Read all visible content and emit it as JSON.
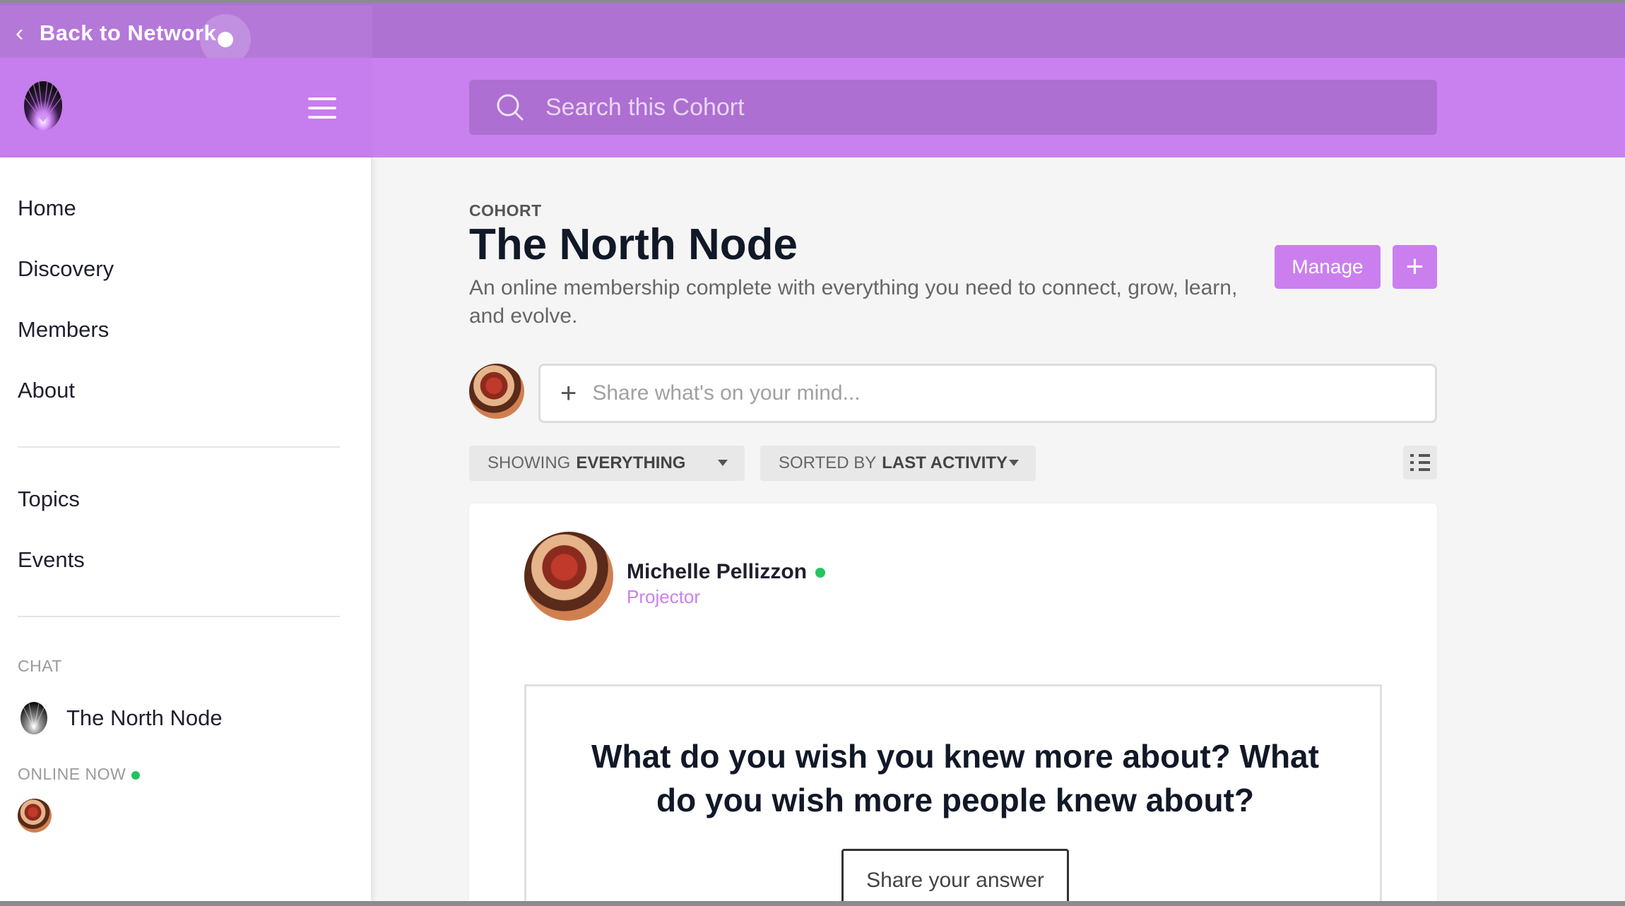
{
  "topbar": {
    "back_label": "Back to Network"
  },
  "search": {
    "placeholder": "Search this Cohort"
  },
  "sidebar": {
    "nav": [
      "Home",
      "Discovery",
      "Members",
      "About"
    ],
    "nav2": [
      "Topics",
      "Events"
    ],
    "chat_label": "CHAT",
    "chat_item": "The North Node",
    "online_label": "ONLINE NOW"
  },
  "main": {
    "eyebrow": "COHORT",
    "title": "The North Node",
    "description": "An online membership complete with everything you need to connect, grow, learn, and evolve.",
    "manage_label": "Manage",
    "plus_label": "+",
    "composer_placeholder": "Share what's on your mind...",
    "filter_show_prefix": "SHOWING",
    "filter_show_value": "EVERYTHING",
    "filter_sort_prefix": "SORTED BY",
    "filter_sort_value": "LAST ACTIVITY"
  },
  "post": {
    "author": "Michelle Pellizzon",
    "role": "Projector",
    "prompt": "What do you wish you knew more about? What do you wish more people knew about?",
    "share_label": "Share your answer"
  },
  "colors": {
    "accent": "#cb7fef",
    "header": "#ca81f0",
    "topbar": "#ae72d2",
    "online": "#22c55e"
  }
}
